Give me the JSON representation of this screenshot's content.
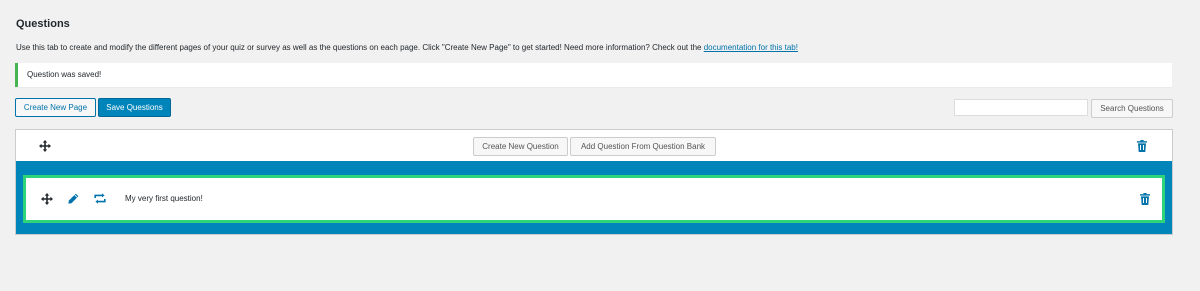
{
  "header": {
    "title": "Questions",
    "intro_text": "Use this tab to create and modify the different pages of your quiz or survey as well as the questions on each page. Click \"Create New Page\" to get started! Need more information? Check out the ",
    "intro_link": "documentation for this tab!"
  },
  "notice": {
    "text": "Question was saved!"
  },
  "toolbar": {
    "create_page_label": "Create New Page",
    "save_questions_label": "Save Questions",
    "search_placeholder": "",
    "search_button_label": "Search Questions"
  },
  "page": {
    "create_question_label": "Create New Question",
    "add_from_bank_label": "Add Question From Question Bank",
    "questions": [
      {
        "text": "My very first question!"
      }
    ]
  },
  "colors": {
    "accent": "#0085ba",
    "notice_border": "#46b450",
    "question_highlight": "#2ed47a"
  }
}
